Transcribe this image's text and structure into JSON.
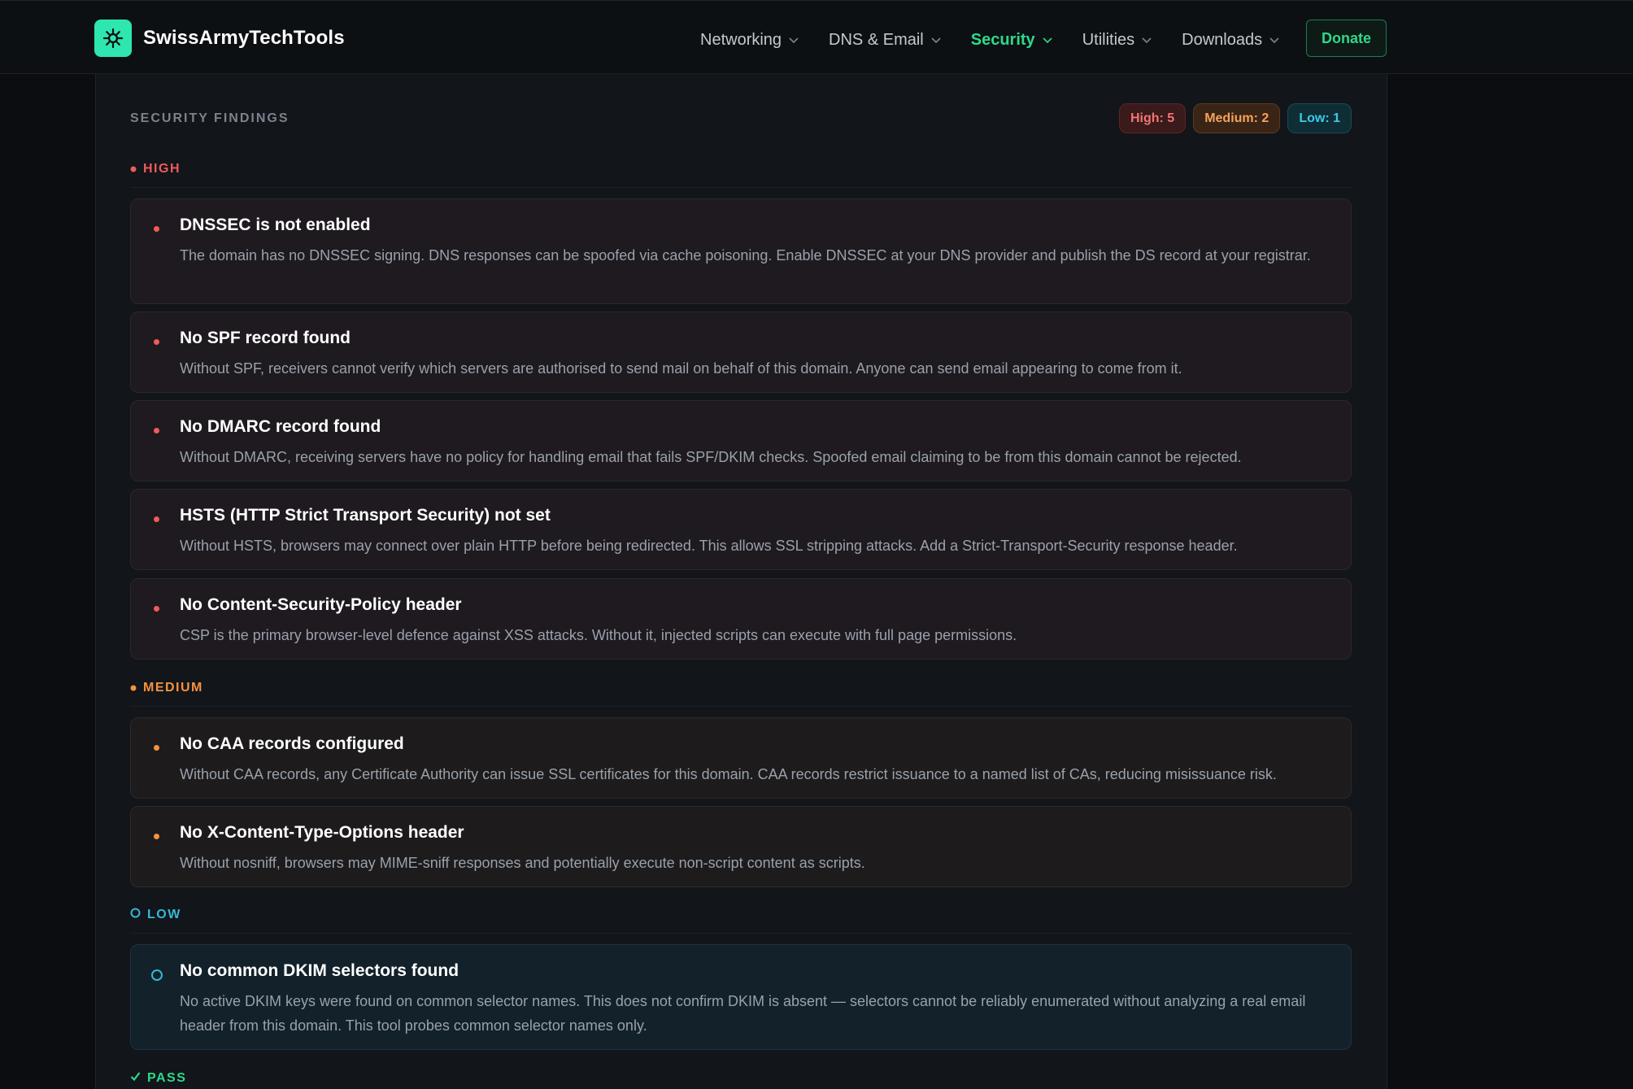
{
  "app": {
    "name": "SwissArmyTechTools",
    "logo_icon": "gear-icon",
    "accent": "#2ee6b0"
  },
  "nav": {
    "items": [
      {
        "label": "Networking",
        "active": false
      },
      {
        "label": "DNS & Email",
        "active": false
      },
      {
        "label": "Security",
        "active": true
      },
      {
        "label": "Utilities",
        "active": false
      },
      {
        "label": "Downloads",
        "active": false
      }
    ],
    "donate_label": "Donate"
  },
  "findings": {
    "title": "SECURITY FINDINGS",
    "badges": {
      "high": "High: 5",
      "medium": "Medium: 2",
      "low": "Low: 1"
    },
    "sections": {
      "high": {
        "label": "HIGH",
        "color": "#f05a5a"
      },
      "medium": {
        "label": "MEDIUM",
        "color": "#f5923e"
      },
      "low": {
        "label": "LOW",
        "color": "#35b8d6"
      },
      "pass": {
        "label": "PASS",
        "color": "#2fd88a"
      }
    },
    "high": [
      {
        "title": "DNSSEC is not enabled",
        "description": "The domain has no DNSSEC signing. DNS responses can be spoofed via cache poisoning. Enable DNSSEC at your DNS provider and publish the DS record at your registrar."
      },
      {
        "title": "No SPF record found",
        "description": "Without SPF, receivers cannot verify which servers are authorised to send mail on behalf of this domain. Anyone can send email appearing to come from it."
      },
      {
        "title": "No DMARC record found",
        "description": "Without DMARC, receiving servers have no policy for handling email that fails SPF/DKIM checks. Spoofed email claiming to be from this domain cannot be rejected."
      },
      {
        "title": "HSTS (HTTP Strict Transport Security) not set",
        "description": "Without HSTS, browsers may connect over plain HTTP before being redirected. This allows SSL stripping attacks. Add a Strict-Transport-Security response header."
      },
      {
        "title": "No Content-Security-Policy header",
        "description": "CSP is the primary browser-level defence against XSS attacks. Without it, injected scripts can execute with full page permissions."
      }
    ],
    "medium": [
      {
        "title": "No CAA records configured",
        "description": "Without CAA records, any Certificate Authority can issue SSL certificates for this domain. CAA records restrict issuance to a named list of CAs, reducing misissuance risk."
      },
      {
        "title": "No X-Content-Type-Options header",
        "description": "Without nosniff, browsers may MIME-sniff responses and potentially execute non-script content as scripts."
      }
    ],
    "low": [
      {
        "title": "No common DKIM selectors found",
        "description": "No active DKIM keys were found on common selector names. This does not confirm DKIM is absent — selectors cannot be reliably enumerated without analyzing a real email header from this domain. This tool probes common selector names only."
      }
    ]
  }
}
